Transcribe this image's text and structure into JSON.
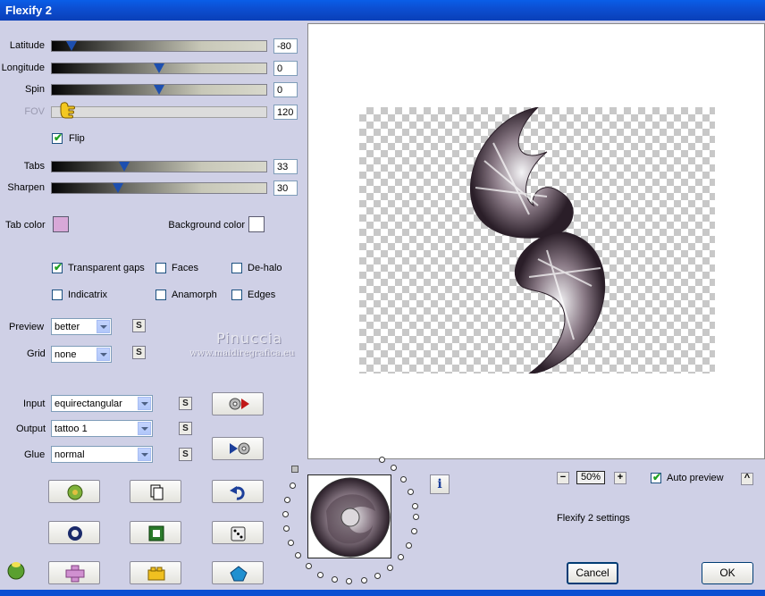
{
  "window": {
    "title": "Flexify 2"
  },
  "sliders": [
    {
      "label": "Latitude",
      "value": "-80",
      "fraction": 0.07,
      "disabled": false
    },
    {
      "label": "Longitude",
      "value": "0",
      "fraction": 0.5,
      "disabled": false
    },
    {
      "label": "Spin",
      "value": "0",
      "fraction": 0.5,
      "disabled": false
    },
    {
      "label": "FOV",
      "value": "120",
      "fraction": 0.02,
      "disabled": true
    },
    {
      "label": "Tabs",
      "value": "33",
      "fraction": 0.33,
      "disabled": false
    },
    {
      "label": "Sharpen",
      "value": "30",
      "fraction": 0.3,
      "disabled": false
    }
  ],
  "flip": {
    "label": "Flip",
    "checked": true
  },
  "colors": {
    "tab_label": "Tab color",
    "tab_color": "#d8a8d8",
    "background_label": "Background color",
    "background_color": "#ffffff"
  },
  "options": {
    "transparent_gaps": {
      "label": "Transparent gaps",
      "checked": true
    },
    "faces": {
      "label": "Faces",
      "checked": false
    },
    "de_halo": {
      "label": "De-halo",
      "checked": false
    },
    "indicatrix": {
      "label": "Indicatrix",
      "checked": false
    },
    "anamorph": {
      "label": "Anamorph",
      "checked": false
    },
    "edges": {
      "label": "Edges",
      "checked": false
    }
  },
  "selects": {
    "preview": {
      "label": "Preview",
      "value": "better"
    },
    "grid": {
      "label": "Grid",
      "value": "none"
    },
    "input": {
      "label": "Input",
      "value": "equirectangular"
    },
    "output": {
      "label": "Output",
      "value": "tattoo 1"
    },
    "glue": {
      "label": "Glue",
      "value": "normal"
    }
  },
  "s_label": "S",
  "watermark": {
    "name": "Pinuccia",
    "url": "www.maidiregrafica.eu"
  },
  "zoom": {
    "minus": "−",
    "value": "50%",
    "plus": "+"
  },
  "auto_preview": {
    "label": "Auto preview",
    "checked": true,
    "collapse": "^"
  },
  "settings_label": "Flexify 2 settings",
  "info_label": "i",
  "buttons": {
    "cancel": "Cancel",
    "ok": "OK"
  }
}
